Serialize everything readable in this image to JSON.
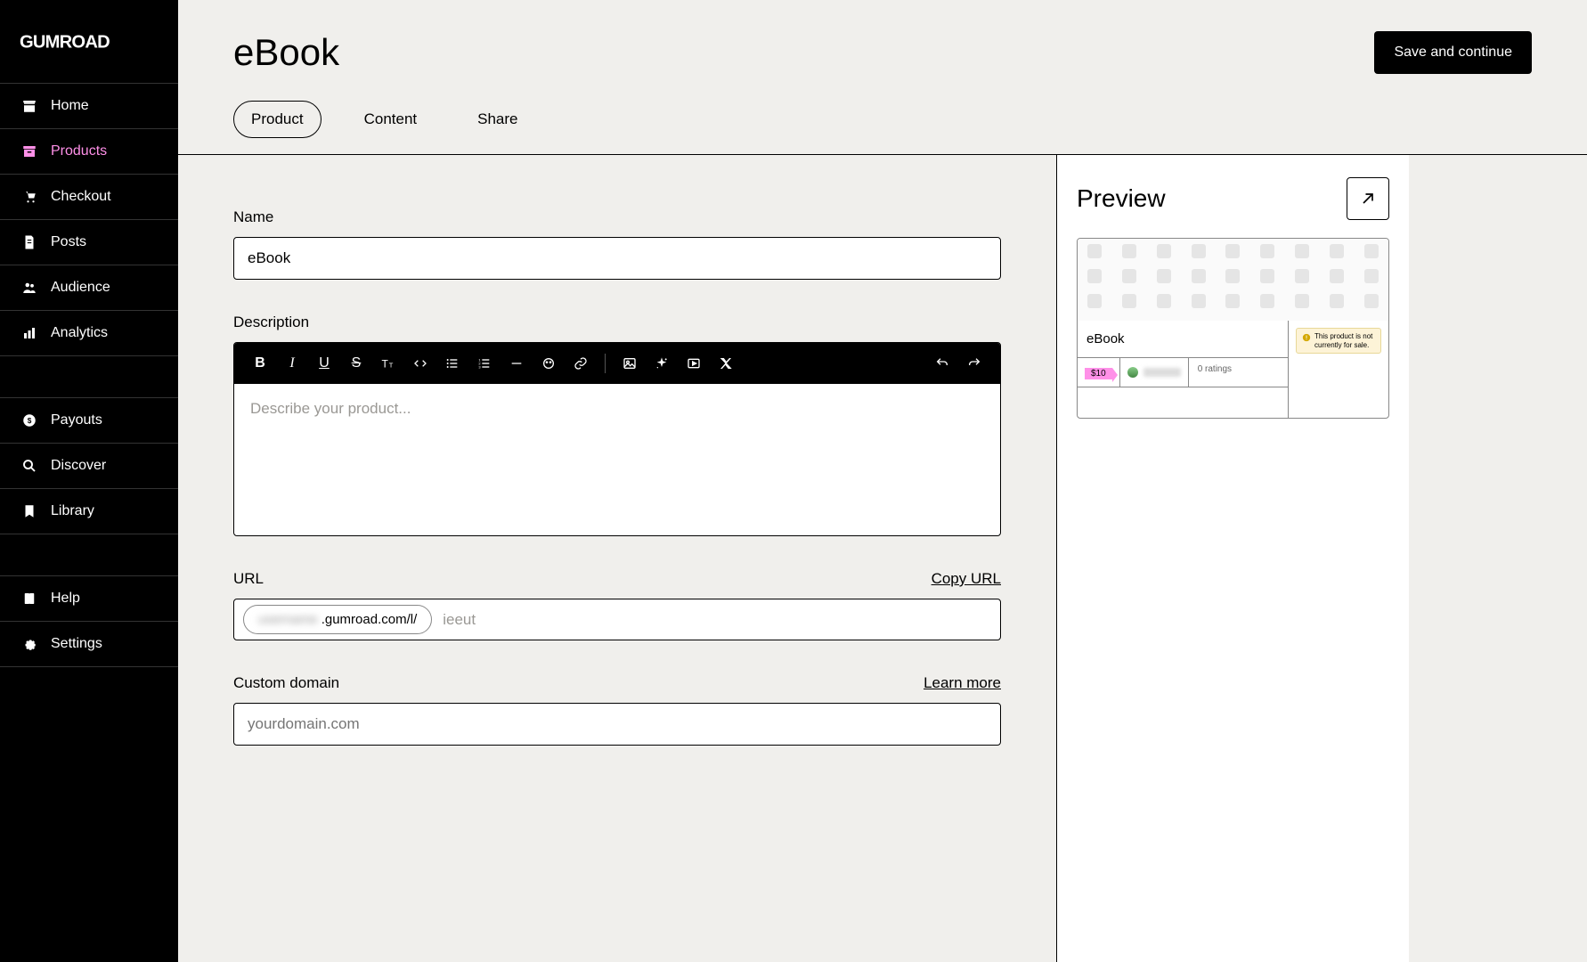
{
  "brand": "GUMROAD",
  "nav": {
    "home": "Home",
    "products": "Products",
    "checkout": "Checkout",
    "posts": "Posts",
    "audience": "Audience",
    "analytics": "Analytics",
    "payouts": "Payouts",
    "discover": "Discover",
    "library": "Library",
    "help": "Help",
    "settings": "Settings"
  },
  "header": {
    "title": "eBook",
    "save_btn": "Save and continue",
    "tabs": {
      "product": "Product",
      "content": "Content",
      "share": "Share"
    }
  },
  "form": {
    "name_label": "Name",
    "name_value": "eBook",
    "description_label": "Description",
    "description_placeholder": "Describe your product...",
    "url_label": "URL",
    "copy_url": "Copy URL",
    "url_prefix_hidden": "username",
    "url_prefix_visible": ".gumroad.com/l/",
    "url_slug": "ieeut",
    "custom_domain_label": "Custom domain",
    "learn_more": "Learn more",
    "custom_domain_placeholder": "yourdomain.com"
  },
  "preview": {
    "title": "Preview",
    "product_name": "eBook",
    "price": "$10",
    "ratings": "0 ratings",
    "warning": "This product is not currently for sale."
  }
}
